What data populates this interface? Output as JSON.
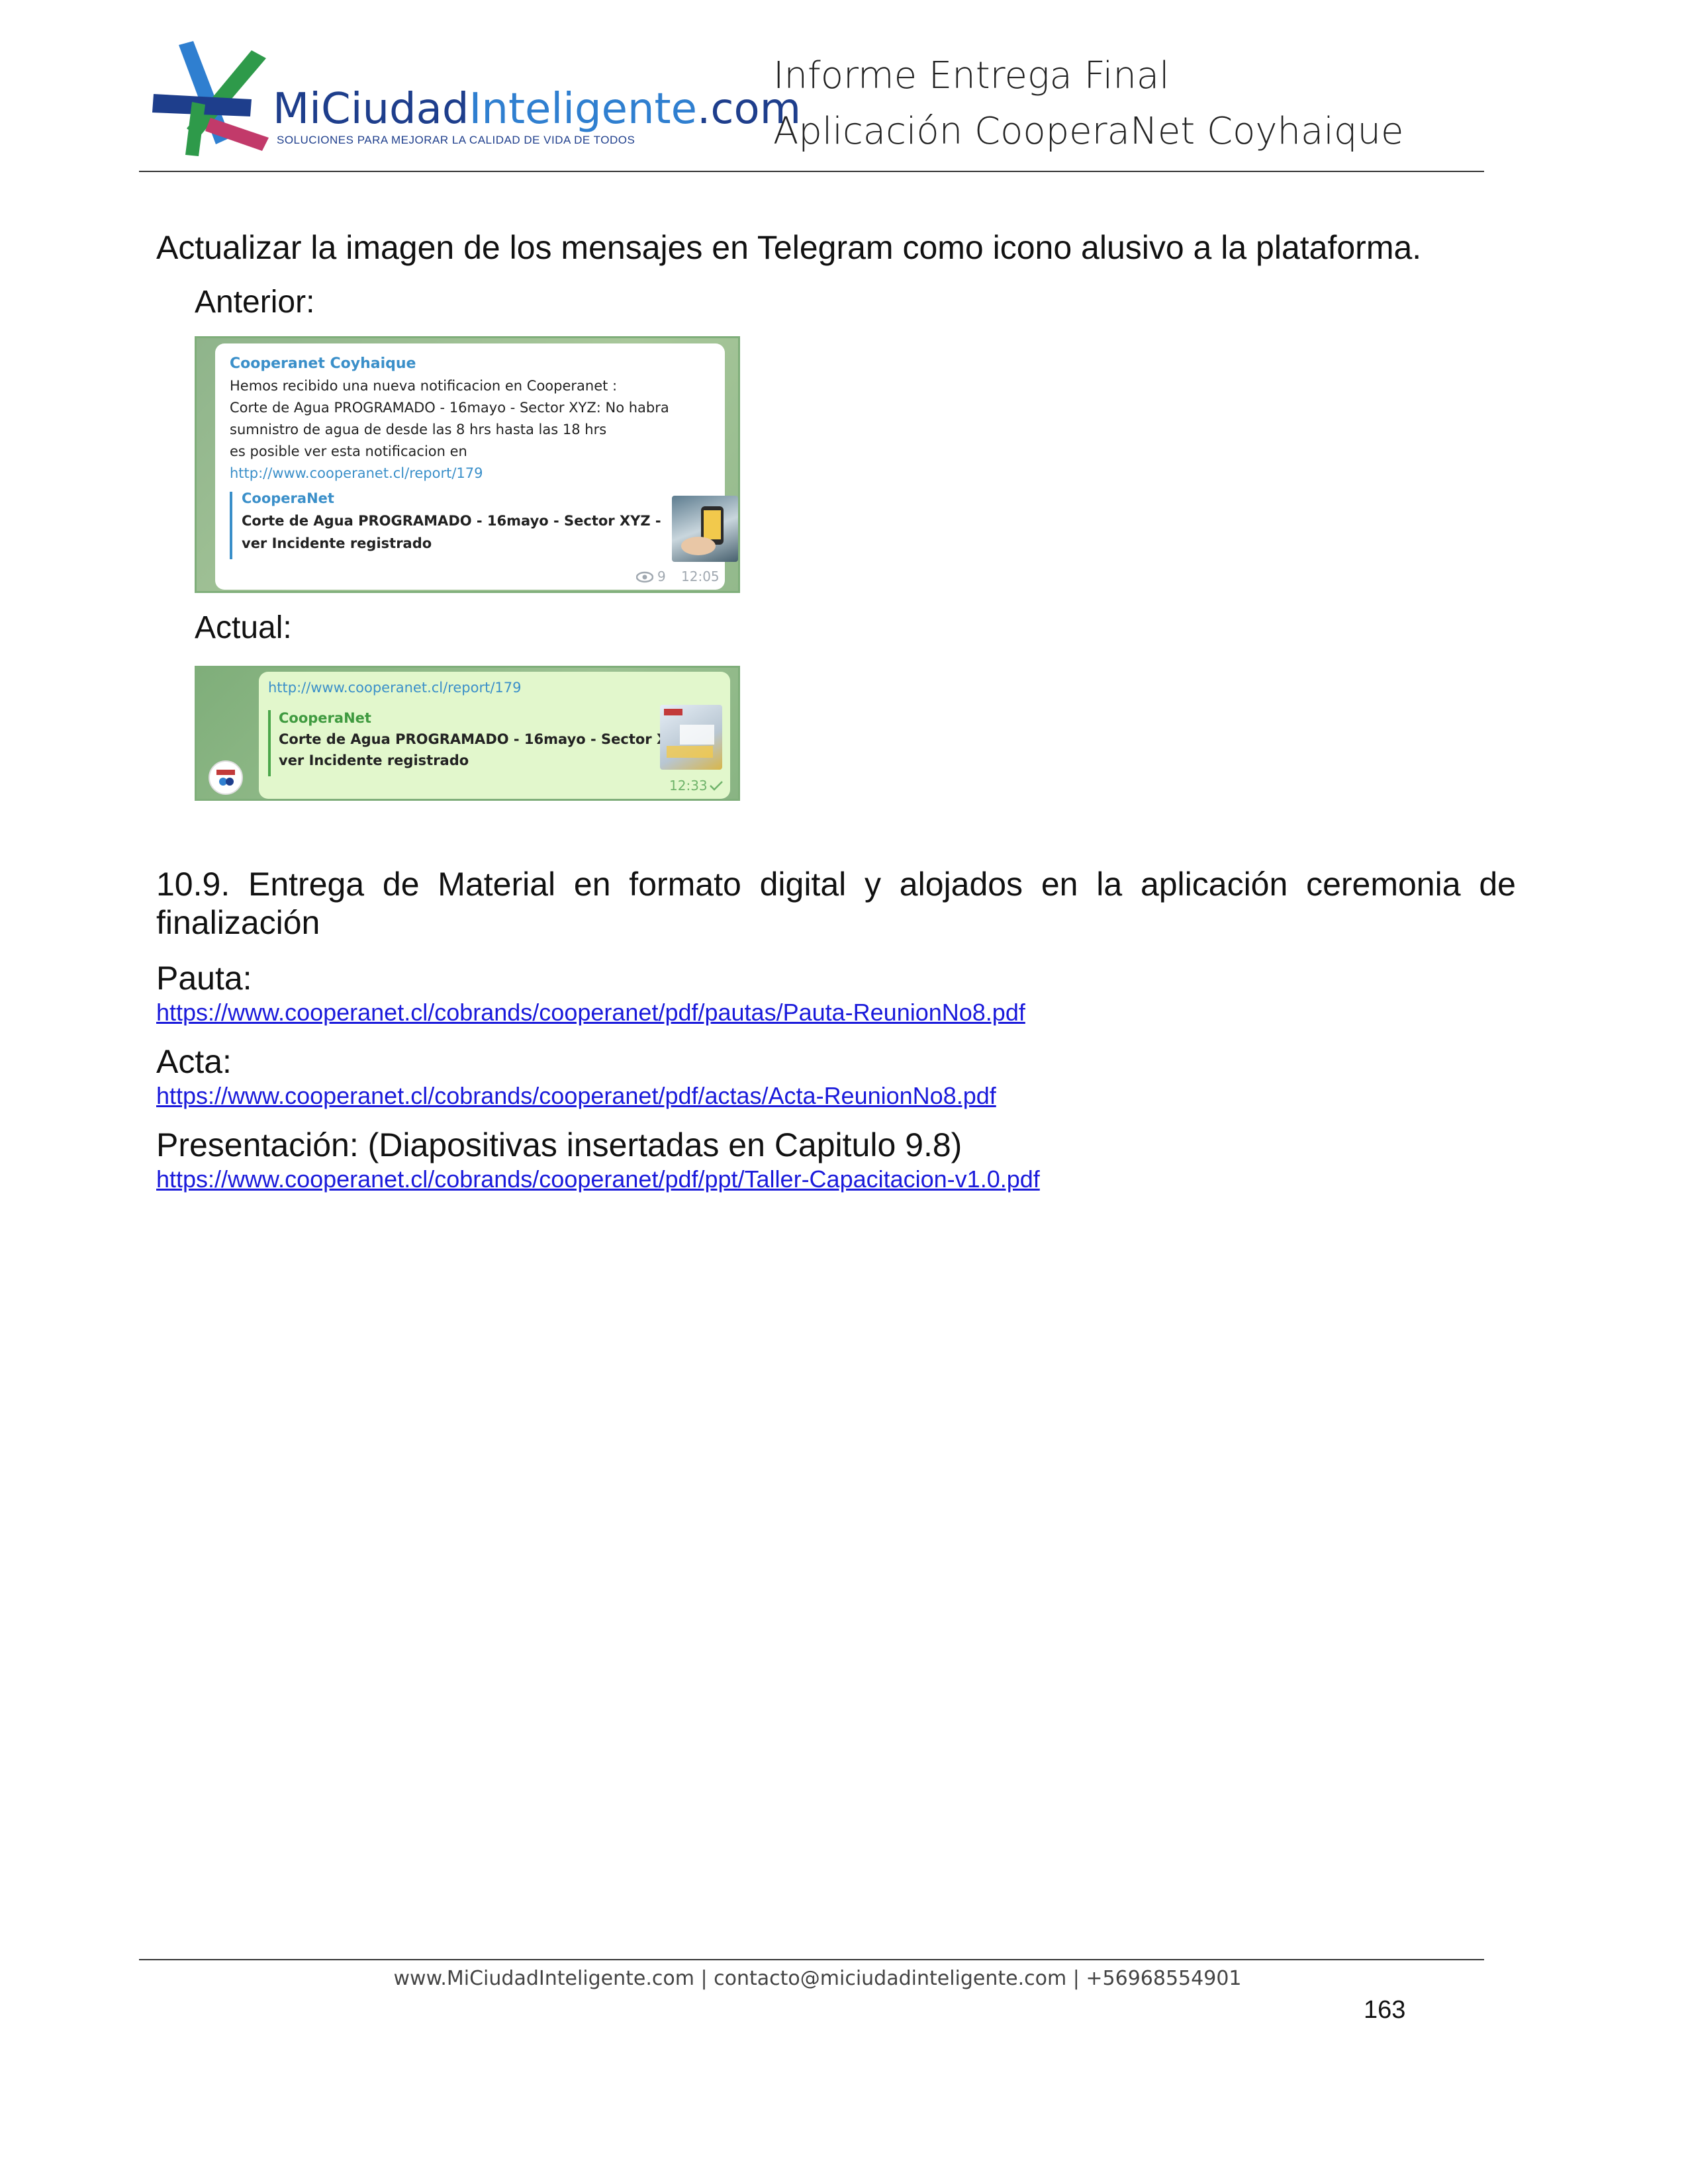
{
  "header": {
    "logo": {
      "name_part1": "MiCiudad",
      "name_part2": "Inteligente",
      "name_part3": ".com",
      "tagline": "SOLUCIONES PARA MEJORAR LA CALIDAD DE VIDA DE TODOS"
    },
    "title_line1": "Informe Entrega Final",
    "title_line2": "Aplicación CooperaNet Coyhaique"
  },
  "body": {
    "intro": "Actualizar la imagen de los mensajes en Telegram como icono alusivo a la plataforma.",
    "label_before": "Anterior:",
    "label_after": "Actual:",
    "screenshot_before": {
      "sender": "Cooperanet Coyhaique",
      "lines": [
        "Hemos recibido una nueva notificacion en Cooperanet :",
        "Corte de Agua PROGRAMADO - 16mayo - Sector XYZ: No habra",
        "sumnistro de agua de desde las 8 hrs hasta las 18 hrs",
        " es posible ver esta notificacion  en"
      ],
      "url": "http://www.cooperanet.cl/report/179",
      "preview_site": "CooperaNet",
      "preview_title_line1": "Corte de Agua PROGRAMADO - 16mayo - Sector XYZ -",
      "preview_title_line2": "ver Incidente registrado",
      "views": "9",
      "time": "12:05"
    },
    "screenshot_after": {
      "url": "http://www.cooperanet.cl/report/179",
      "preview_site": "CooperaNet",
      "preview_title_line1": "Corte de Agua PROGRAMADO - 16mayo - Sector XYZ -",
      "preview_title_line2": "ver Incidente registrado",
      "time": "12:33"
    },
    "section_heading_line1": "10.9.  Entrega  de  Material  en  formato  digital  y  alojados  en  la  aplicación  ceremonia  de",
    "section_heading_line2": "finalización",
    "pauta_label": "Pauta:",
    "pauta_link": "https://www.cooperanet.cl/cobrands/cooperanet/pdf/pautas/Pauta-ReunionNo8.pdf",
    "acta_label": "Acta:",
    "acta_link": "https://www.cooperanet.cl/cobrands/cooperanet/pdf/actas/Acta-ReunionNo8.pdf",
    "presentacion_label": "Presentación: (Diapositivas insertadas en Capitulo 9.8)",
    "presentacion_link": "https://www.cooperanet.cl/cobrands/cooperanet/pdf/ppt/Taller-Capacitacion-v1.0.pdf"
  },
  "footer": {
    "contact": "www.MiCiudadInteligente.com | contacto@miciudadinteligente.com | +56968554901",
    "page_number": "163"
  },
  "colors": {
    "link": "#1a1adb",
    "logo_dark_blue": "#1e3e8c",
    "logo_light_blue": "#2f7fd0",
    "logo_green": "#2e9a4a",
    "telegram_border": "#7fae7a"
  }
}
